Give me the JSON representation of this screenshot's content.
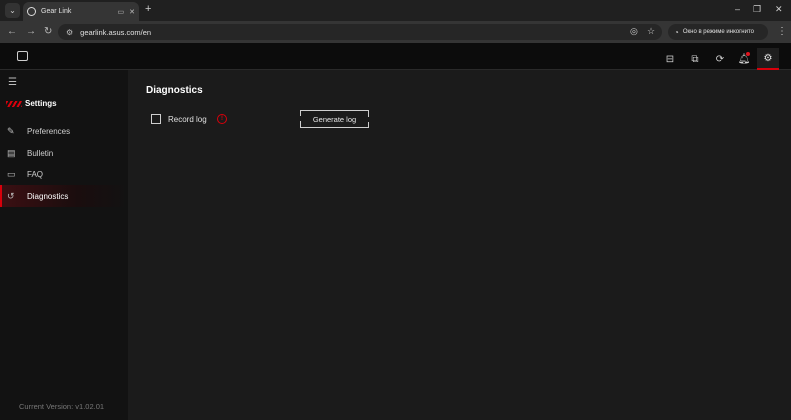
{
  "browser": {
    "tab_title": "Gear Link",
    "url": "gearlink.asus.com/en",
    "incognito_label": "Окно в режиме инкогнито",
    "icons": {
      "tab_list": "chevron-down-icon",
      "favicon": "gearlink-favicon",
      "new_tab": "plus-icon",
      "back": "arrow-left-icon",
      "forward": "arrow-right-icon",
      "reload": "reload-icon",
      "eye_off": "eye-off-icon",
      "star": "star-icon",
      "menu": "dots-vertical-icon"
    }
  },
  "header": {
    "icons": [
      "display-icon",
      "image-edit-icon",
      "sync-icon",
      "bell-icon",
      "gear-icon"
    ],
    "active_icon": "gear-icon",
    "accent": "#d8000b"
  },
  "sidebar": {
    "title": "Settings",
    "items": [
      {
        "label": "Preferences",
        "icon": "brush-icon"
      },
      {
        "label": "Bulletin",
        "icon": "message-icon"
      },
      {
        "label": "FAQ",
        "icon": "chat-icon"
      },
      {
        "label": "Diagnostics",
        "icon": "history-icon",
        "active": true
      }
    ],
    "version": "Current Version: v1.02.01"
  },
  "main": {
    "title": "Diagnostics",
    "record_label": "Record log",
    "record_checked": false,
    "info_icon": "info-icon",
    "generate_label": "Generate log"
  }
}
